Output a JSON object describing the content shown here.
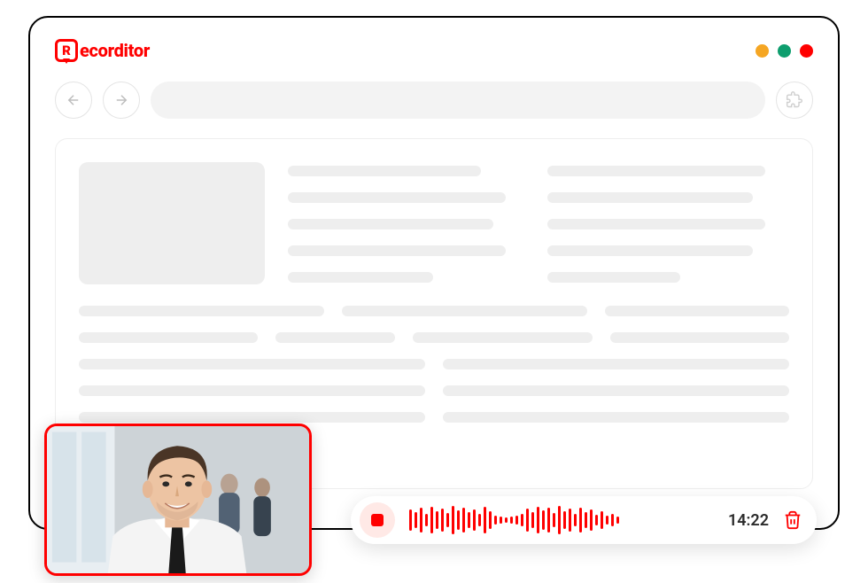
{
  "app": {
    "name_prefix": "R",
    "name_rest": "ecorditor"
  },
  "window_controls": {
    "minimize_color": "#f5a623",
    "maximize_color": "#0e9e6e",
    "close_color": "#ff0000"
  },
  "toolbar": {
    "back_icon": "arrow-left",
    "forward_icon": "arrow-right",
    "address_value": "",
    "extension_icon": "puzzle"
  },
  "recording": {
    "elapsed_time": "14:22",
    "stop_icon": "stop",
    "delete_icon": "trash"
  },
  "webcam": {
    "description": "Man in white shirt and tie, office background with two people"
  }
}
